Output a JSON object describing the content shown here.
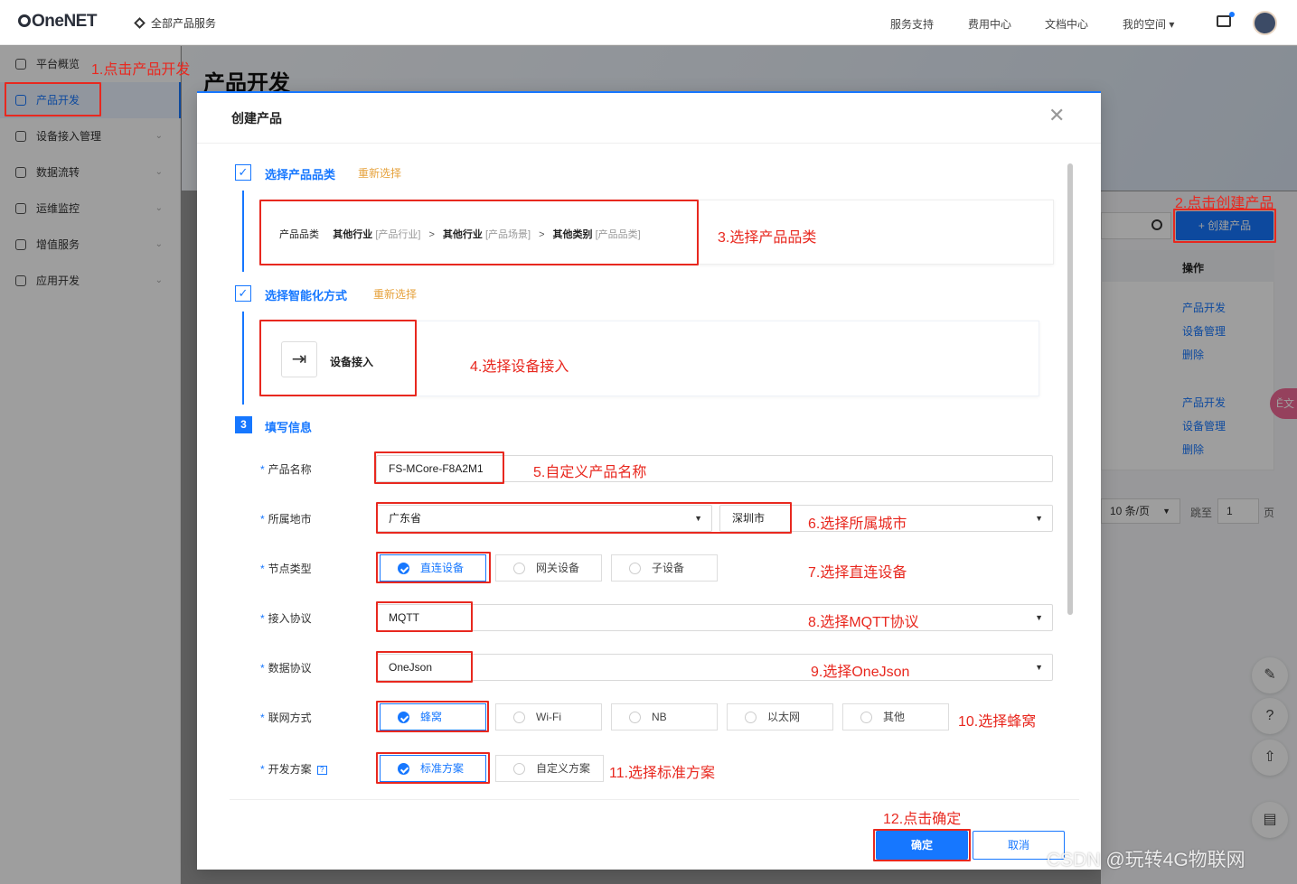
{
  "header": {
    "logo": "OneNET",
    "all_products": "全部产品服务",
    "nav": [
      "服务支持",
      "费用中心",
      "文档中心",
      "我的空间 ▾"
    ]
  },
  "sidebar": {
    "items": [
      {
        "label": "平台概览"
      },
      {
        "label": "产品开发"
      },
      {
        "label": "设备接入管理"
      },
      {
        "label": "数据流转"
      },
      {
        "label": "运维监控"
      },
      {
        "label": "增值服务"
      },
      {
        "label": "应用开发"
      }
    ]
  },
  "page": {
    "title": "产品开发",
    "create_button": "+  创建产品",
    "table_header_op": "操作",
    "ops_row1": [
      "产品开发",
      "设备管理",
      "删除"
    ],
    "ops_row2": [
      "产品开发",
      "设备管理",
      "删除"
    ],
    "page_size": "10 条/页",
    "jump_label": "跳至",
    "jump_value": "1",
    "page_suffix": "页",
    "translate": "Ě文"
  },
  "modal": {
    "title": "创建产品",
    "step1": {
      "title": "选择产品品类",
      "reselect": "重新选择"
    },
    "category": {
      "label": "产品品类",
      "industry": "其他行业",
      "industry_tag": "[产品行业]",
      "scene": "其他行业",
      "scene_tag": "[产品场景]",
      "kind": "其他类别",
      "kind_tag": "[产品品类]",
      "sep": ">"
    },
    "step2": {
      "title": "选择智能化方式",
      "reselect": "重新选择"
    },
    "mode": {
      "label": "设备接入"
    },
    "step3": {
      "num": "3",
      "title": "填写信息"
    },
    "form": {
      "name_label": "产品名称",
      "name_value": "FS-MCore-F8A2M1",
      "region_label": "所属地市",
      "province": "广东省",
      "city": "深圳市",
      "node_label": "节点类型",
      "node_options": [
        "直连设备",
        "网关设备",
        "子设备"
      ],
      "protocol_label": "接入协议",
      "protocol_value": "MQTT",
      "data_label": "数据协议",
      "data_value": "OneJson",
      "network_label": "联网方式",
      "network_options": [
        "蜂窝",
        "Wi-Fi",
        "NB",
        "以太网",
        "其他"
      ],
      "plan_label": "开发方案",
      "plan_help": "?",
      "plan_options": [
        "标准方案",
        "自定义方案"
      ]
    },
    "ok": "确定",
    "cancel": "取消"
  },
  "annotations": [
    "1.点击产品开发",
    "2.点击创建产品",
    "3.选择产品品类",
    "4.选择设备接入",
    "5.自定义产品名称",
    "6.选择所属城市",
    "7.选择直连设备",
    "8.选择MQTT协议",
    "9.选择OneJson",
    "10.选择蜂窝",
    "11.选择标准方案",
    "12.点击确定"
  ],
  "watermark": "CSDN @玩转4G物联网",
  "colors": {
    "primary": "#1677ff",
    "annotation": "#e8281f",
    "reselect": "#e6a23c"
  }
}
